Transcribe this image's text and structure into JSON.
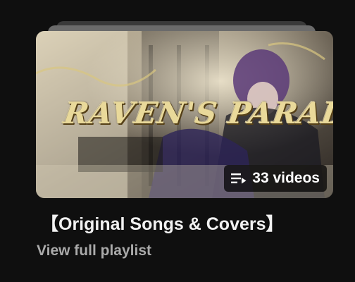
{
  "playlist": {
    "thumbnail_text": "RAVEN'S PARADIGM",
    "video_count_label": "33 videos",
    "title": "【Original Songs & Covers】",
    "view_full_label": "View full playlist"
  },
  "icons": {
    "badge": "playlist-icon"
  },
  "colors": {
    "background": "#0f0f0f",
    "title": "#f1f1f1",
    "secondary_text": "#aaaaaa",
    "badge_bg": "rgba(0,0,0,0.72)"
  }
}
